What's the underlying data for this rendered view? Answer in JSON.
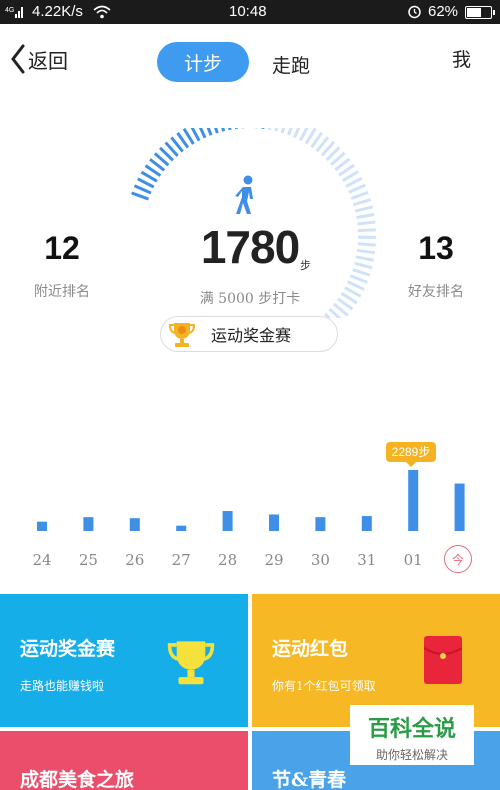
{
  "status_bar": {
    "signal": "4G",
    "speed": "4.22K/s",
    "time": "10:48",
    "battery": "62%",
    "battery_level": 0.62
  },
  "header": {
    "back_label": "返回",
    "tabs": [
      {
        "label": "计步",
        "active": true
      },
      {
        "label": "走跑",
        "active": false
      }
    ],
    "me_label": "我"
  },
  "gauge": {
    "steps": "1780",
    "steps_unit": "步",
    "goal_text": "满 5000 步打卡",
    "progress": 0.356
  },
  "stats": {
    "nearby_rank": "12",
    "nearby_label": "附近排名",
    "friend_rank": "13",
    "friend_label": "好友排名"
  },
  "contest_button": {
    "label": "运动奖金赛",
    "icon": "trophy-icon"
  },
  "chart_data": {
    "type": "bar",
    "categories": [
      "24",
      "25",
      "26",
      "27",
      "28",
      "29",
      "30",
      "31",
      "01",
      "今"
    ],
    "values": [
      350,
      520,
      480,
      200,
      750,
      620,
      520,
      560,
      2289,
      1780
    ],
    "highlight_label": "2289步",
    "color": "#3f8fe6"
  },
  "cards": [
    {
      "title": "运动奖金赛",
      "subtitle": "走路也能赚钱啦",
      "icon": "trophy-icon",
      "color": "#16aee8"
    },
    {
      "title": "运动红包",
      "subtitle": "你有1个红包可领取",
      "icon": "red-envelope-icon",
      "color": "#f6b825"
    },
    {
      "title": "成都美食之旅",
      "subtitle": "",
      "color": "#ea4e6b"
    },
    {
      "title": "节&青春",
      "subtitle": "",
      "color": "#4aa3e8"
    }
  ],
  "watermark": {
    "title": "百科全说",
    "subtitle": "助你轻松解决"
  }
}
